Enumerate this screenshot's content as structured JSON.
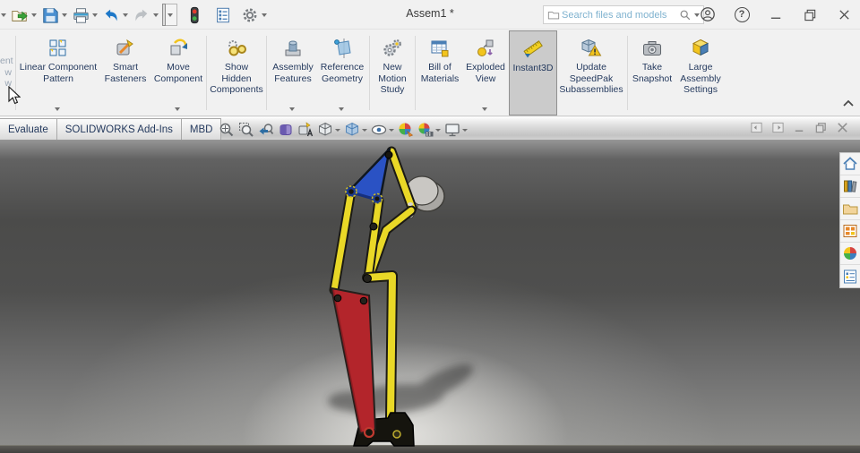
{
  "titlebar": {
    "title": "Assem1 *",
    "search": {
      "placeholder": "Search files and models"
    },
    "quick_tools": [
      "new",
      "open",
      "save",
      "print",
      "undo",
      "redo",
      "select",
      "rebuild",
      "file-properties",
      "options"
    ],
    "window_controls": [
      "user-account",
      "help",
      "minimize",
      "restore",
      "close"
    ]
  },
  "glyphs": {
    "help": "?"
  },
  "ribbon": {
    "partial_label": "ent\nw\nw",
    "items": [
      {
        "label": "Linear Component\nPattern",
        "icon": "linear-component-pattern",
        "caret": true
      },
      {
        "label": "Smart\nFasteners",
        "icon": "smart-fasteners",
        "caret": false
      },
      {
        "label": "Move\nComponent",
        "icon": "move-component",
        "caret": true
      },
      {
        "label": "Show\nHidden\nComponents",
        "icon": "show-hidden-components",
        "caret": false
      },
      {
        "label": "Assembly\nFeatures",
        "icon": "assembly-features",
        "caret": true
      },
      {
        "label": "Reference\nGeometry",
        "icon": "reference-geometry",
        "caret": true
      },
      {
        "label": "New\nMotion\nStudy",
        "icon": "new-motion-study",
        "caret": false
      },
      {
        "label": "Bill of\nMaterials",
        "icon": "bill-of-materials",
        "caret": false
      },
      {
        "label": "Exploded\nView",
        "icon": "exploded-view",
        "caret": true
      },
      {
        "label": "Instant3D",
        "icon": "instant3d",
        "caret": false,
        "pressed": true
      },
      {
        "label": "Update\nSpeedPak\nSubassemblies",
        "icon": "update-speedpak",
        "caret": false
      },
      {
        "label": "Take\nSnapshot",
        "icon": "take-snapshot",
        "caret": false
      },
      {
        "label": "Large\nAssembly\nSettings",
        "icon": "large-assembly-settings",
        "caret": false
      }
    ]
  },
  "tabbar": {
    "tabs": [
      "Evaluate",
      "SOLIDWORKS Add-Ins",
      "MBD"
    ]
  },
  "headsup": {
    "icons": [
      "zoom-to-fit",
      "zoom-to-area",
      "previous-view",
      "section-view",
      "dynamic-annotation-views",
      "view-orientation",
      "display-style",
      "hide-show-items",
      "edit-appearance",
      "apply-scene",
      "view-settings"
    ]
  },
  "document_window": {
    "controls": [
      "collapse-left-pane",
      "collapse-right-pane",
      "minimize",
      "restore",
      "close"
    ]
  },
  "taskpane": {
    "tabs": [
      "solidworks-resources",
      "design-library",
      "file-explorer",
      "view-palette",
      "appearances-scenes",
      "custom-properties"
    ]
  },
  "viewport": {
    "part_colors": {
      "links": "#e9d827",
      "triangle_plate": "#2a52c4",
      "long_link": "#b3252b",
      "foot": "#15140e",
      "crank_disk": "#b8b6b2"
    },
    "backdrop": {
      "top": "#4b4b4a",
      "bottom": "#8d8d8b",
      "floor": "#4a4946"
    }
  }
}
